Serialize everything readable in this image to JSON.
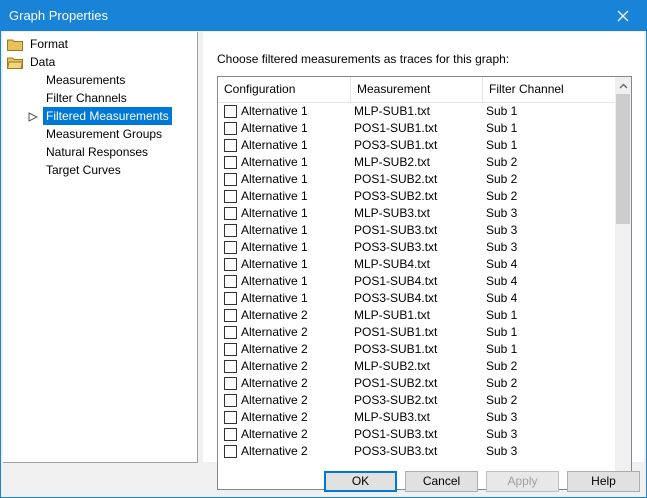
{
  "window": {
    "title": "Graph Properties"
  },
  "tree": {
    "items": [
      {
        "label": "Format",
        "folder": true
      },
      {
        "label": "Data",
        "folder": true
      },
      {
        "label": "Measurements"
      },
      {
        "label": "Filter Channels"
      },
      {
        "label": "Filtered Measurements",
        "selected": true
      },
      {
        "label": "Measurement Groups"
      },
      {
        "label": "Natural Responses"
      },
      {
        "label": "Target Curves"
      }
    ]
  },
  "panel": {
    "prompt": "Choose filtered measurements as traces for this graph:",
    "columns": [
      "Configuration",
      "Measurement",
      "Filter Channel"
    ],
    "rows": [
      [
        "Alternative 1",
        "MLP-SUB1.txt",
        "Sub 1"
      ],
      [
        "Alternative 1",
        "POS1-SUB1.txt",
        "Sub 1"
      ],
      [
        "Alternative 1",
        "POS3-SUB1.txt",
        "Sub 1"
      ],
      [
        "Alternative 1",
        "MLP-SUB2.txt",
        "Sub 2"
      ],
      [
        "Alternative 1",
        "POS1-SUB2.txt",
        "Sub 2"
      ],
      [
        "Alternative 1",
        "POS3-SUB2.txt",
        "Sub 2"
      ],
      [
        "Alternative 1",
        "MLP-SUB3.txt",
        "Sub 3"
      ],
      [
        "Alternative 1",
        "POS1-SUB3.txt",
        "Sub 3"
      ],
      [
        "Alternative 1",
        "POS3-SUB3.txt",
        "Sub 3"
      ],
      [
        "Alternative 1",
        "MLP-SUB4.txt",
        "Sub 4"
      ],
      [
        "Alternative 1",
        "POS1-SUB4.txt",
        "Sub 4"
      ],
      [
        "Alternative 1",
        "POS3-SUB4.txt",
        "Sub 4"
      ],
      [
        "Alternative 2",
        "MLP-SUB1.txt",
        "Sub 1"
      ],
      [
        "Alternative 2",
        "POS1-SUB1.txt",
        "Sub 1"
      ],
      [
        "Alternative 2",
        "POS3-SUB1.txt",
        "Sub 1"
      ],
      [
        "Alternative 2",
        "MLP-SUB2.txt",
        "Sub 2"
      ],
      [
        "Alternative 2",
        "POS1-SUB2.txt",
        "Sub 2"
      ],
      [
        "Alternative 2",
        "POS3-SUB2.txt",
        "Sub 2"
      ],
      [
        "Alternative 2",
        "MLP-SUB3.txt",
        "Sub 3"
      ],
      [
        "Alternative 2",
        "POS1-SUB3.txt",
        "Sub 3"
      ],
      [
        "Alternative 2",
        "POS3-SUB3.txt",
        "Sub 3"
      ]
    ]
  },
  "buttons": {
    "ok": "OK",
    "cancel": "Cancel",
    "apply": "Apply",
    "help": "Help"
  },
  "colors": {
    "titlebar": "#1883d7",
    "selection": "#0078d7",
    "folder": "#e8c05c"
  }
}
